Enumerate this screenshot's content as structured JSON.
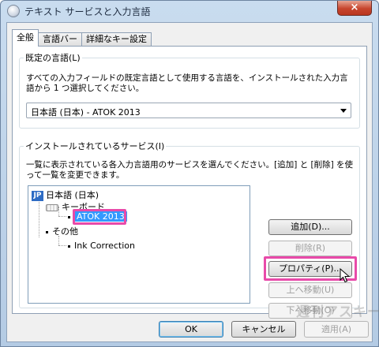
{
  "window": {
    "title": "テキスト サービスと入力言語",
    "close_label": "×"
  },
  "tabs": [
    {
      "label": "全般",
      "active": true
    },
    {
      "label": "言語バー",
      "active": false
    },
    {
      "label": "詳細なキー設定",
      "active": false
    }
  ],
  "default_language": {
    "legend": "既定の言語(L)",
    "description": "すべての入力フィールドの既定言語として使用する言語を、インストールされた入力言語から 1 つ選択してください。",
    "selected": "日本語 (日本) - ATOK 2013"
  },
  "installed_services": {
    "legend": "インストールされているサービス(I)",
    "description": "一覧に表示されている各入力言語用のサービスを選んでください。[追加] と [削除] を使って一覧を変更できます。",
    "tree": {
      "language_badge": "JP",
      "language": "日本語 (日本)",
      "keyboard_group": "キーボード",
      "keyboard_item": "ATOK 2013",
      "other_group": "その他",
      "other_item": "Ink Correction"
    },
    "buttons": {
      "add": "追加(D)...",
      "remove": "削除(R)",
      "properties": "プロパティ(P)...",
      "move_up": "上へ移動(U)",
      "move_down": "下へ移動(O)"
    }
  },
  "footer": {
    "ok": "OK",
    "cancel": "キャンセル",
    "apply": "適用(A)"
  },
  "watermark": "週刊アスキー",
  "colors": {
    "highlight": "#e84aa9",
    "selection": "#3399ff",
    "jp_badge": "#2e6cc4"
  },
  "icons": [
    "input-settings-icon",
    "keyboard-icon",
    "mouse-cursor-icon",
    "chevron-down-icon"
  ]
}
